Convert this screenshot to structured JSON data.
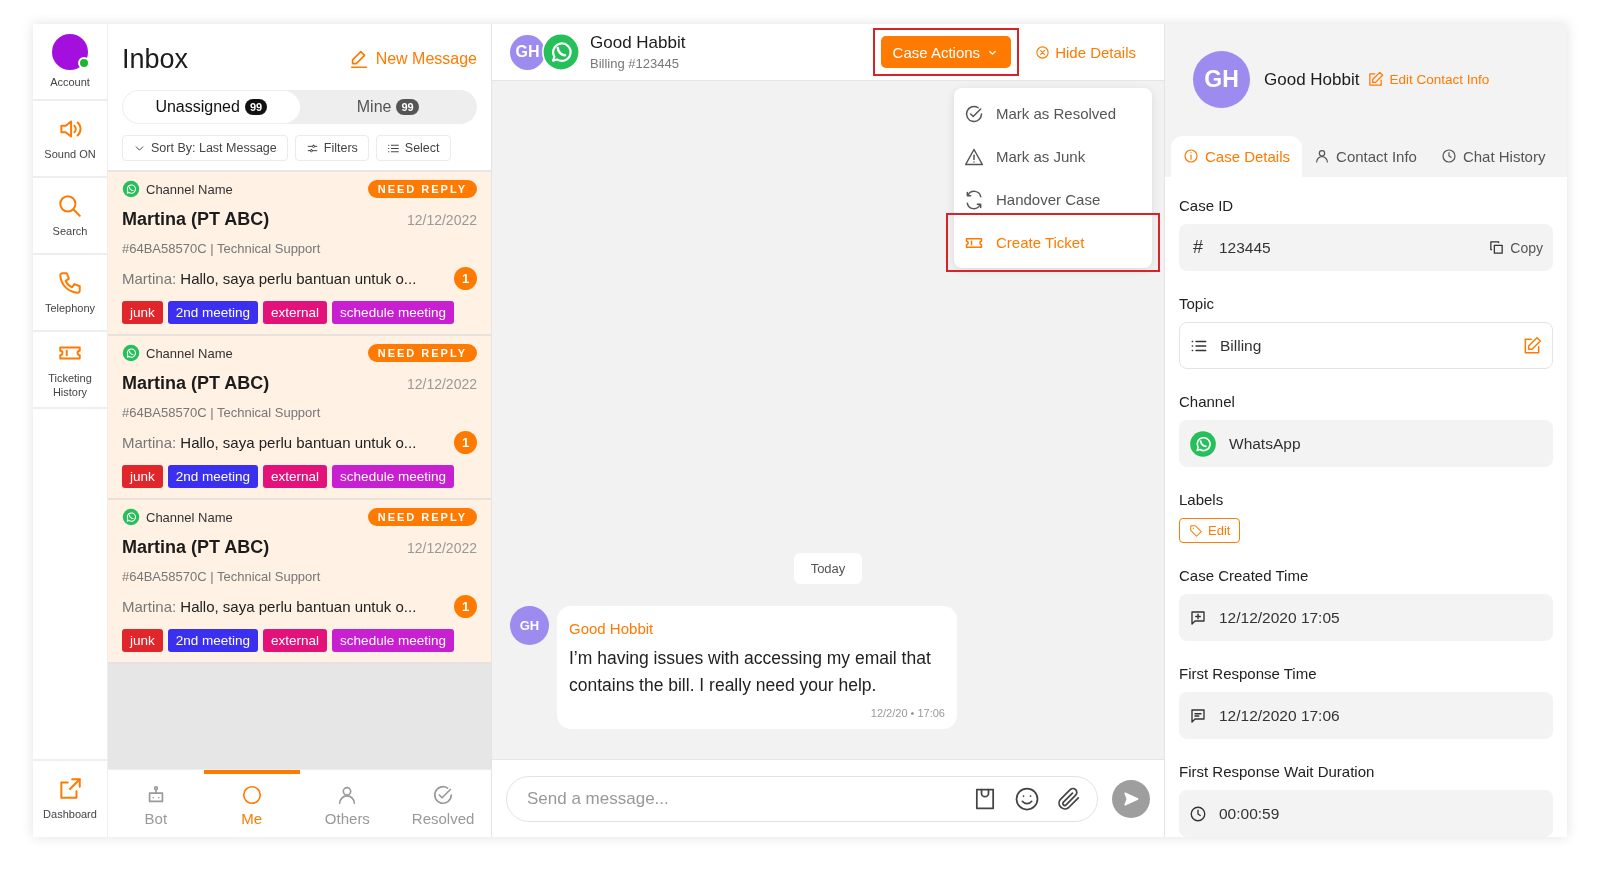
{
  "nav": {
    "account": {
      "label": "Account",
      "online": true
    },
    "items": [
      {
        "kind": "sound",
        "label": "Sound ON"
      },
      {
        "kind": "search",
        "label": "Search"
      },
      {
        "kind": "phone",
        "label": "Telephony"
      },
      {
        "kind": "ticket",
        "label": "Ticketing History"
      }
    ],
    "bottom": {
      "kind": "dashboard",
      "label": "Dashboard"
    }
  },
  "inbox": {
    "title": "Inbox",
    "new_message": "New Message",
    "tabs": [
      {
        "label": "Unassigned",
        "count": "99",
        "selected": true
      },
      {
        "label": "Mine",
        "count": "99",
        "selected": false
      }
    ],
    "toolbar": {
      "sort": "Sort By: Last Message",
      "filters": "Filters",
      "select": "Select"
    },
    "conversations": [
      {
        "channel": "Channel Name",
        "status": "NEED REPLY",
        "name": "Martina (PT ABC)",
        "date": "12/12/2022",
        "ref": "#64BA58570C | Technical Support",
        "preview_sender": "Martina:",
        "preview_text": "Hallo, saya perlu bantuan untuk o...",
        "unread": "1",
        "labels": [
          {
            "text": "junk",
            "color": "#e0262b"
          },
          {
            "text": "2nd meeting",
            "color": "#3b2ff0"
          },
          {
            "text": "external",
            "color": "#e3127a"
          },
          {
            "text": "schedule meeting",
            "color": "#c81fd0"
          }
        ]
      },
      {
        "channel": "Channel Name",
        "status": "NEED REPLY",
        "name": "Martina (PT ABC)",
        "date": "12/12/2022",
        "ref": "#64BA58570C | Technical Support",
        "preview_sender": "Martina:",
        "preview_text": "Hallo, saya perlu bantuan untuk o...",
        "unread": "1",
        "labels": [
          {
            "text": "junk",
            "color": "#e0262b"
          },
          {
            "text": "2nd meeting",
            "color": "#3b2ff0"
          },
          {
            "text": "external",
            "color": "#e3127a"
          },
          {
            "text": "schedule meeting",
            "color": "#c81fd0"
          }
        ]
      },
      {
        "channel": "Channel Name",
        "status": "NEED REPLY",
        "name": "Martina (PT ABC)",
        "date": "12/12/2022",
        "ref": "#64BA58570C | Technical Support",
        "preview_sender": "Martina:",
        "preview_text": "Hallo, saya perlu bantuan untuk o...",
        "unread": "1",
        "labels": [
          {
            "text": "junk",
            "color": "#e0262b"
          },
          {
            "text": "2nd meeting",
            "color": "#3b2ff0"
          },
          {
            "text": "external",
            "color": "#e3127a"
          },
          {
            "text": "schedule meeting",
            "color": "#c81fd0"
          }
        ]
      }
    ],
    "bottom_tabs": [
      {
        "kind": "bot",
        "label": "Bot",
        "selected": false
      },
      {
        "kind": "me",
        "label": "Me",
        "selected": true
      },
      {
        "kind": "others",
        "label": "Others",
        "selected": false
      },
      {
        "kind": "resolved",
        "label": "Resolved",
        "selected": false
      }
    ]
  },
  "chat": {
    "initials": "GH",
    "name": "Good Habbit",
    "subtitle": "Billing #123445",
    "case_actions": {
      "label": "Case Actions",
      "highlighted": true
    },
    "hide_details": "Hide Details",
    "menu": [
      {
        "kind": "resolved",
        "label": "Mark as Resolved",
        "selected": false,
        "highlighted": false
      },
      {
        "kind": "warning",
        "label": "Mark as Junk",
        "selected": false,
        "highlighted": false
      },
      {
        "kind": "handover",
        "label": "Handover Case",
        "selected": false,
        "highlighted": false
      },
      {
        "kind": "ticket",
        "label": "Create Ticket",
        "selected": true,
        "highlighted": true
      }
    ],
    "date_divider": "Today",
    "message": {
      "initials": "GH",
      "sender": "Good Hobbit",
      "text": "I’m having issues with accessing my email that contains the bill. I really need your help.",
      "time": "12/2/20 • 17:06"
    },
    "composer": {
      "placeholder": "Send a message..."
    }
  },
  "details": {
    "initials": "GH",
    "name": "Good Hobbit",
    "edit_link": "Edit Contact Info",
    "tabs": [
      {
        "kind": "info",
        "label": "Case Details",
        "selected": true
      },
      {
        "kind": "others",
        "label": "Contact Info",
        "selected": false
      },
      {
        "kind": "clock",
        "label": "Chat History",
        "selected": false
      }
    ],
    "fields": [
      {
        "kind": "id",
        "label": "Case ID",
        "prefix": "#",
        "value": "123445",
        "action": "Copy"
      },
      {
        "kind": "topic",
        "label": "Topic",
        "value": "Billing"
      },
      {
        "kind": "channel",
        "label": "Channel",
        "value": "WhatsApp"
      },
      {
        "kind": "labels",
        "label": "Labels",
        "action": "Edit"
      },
      {
        "kind": "created",
        "label": "Case Created Time",
        "value": "12/12/2020 17:05"
      },
      {
        "kind": "responded",
        "label": "First Response Time",
        "value": "12/12/2020 17:06"
      },
      {
        "kind": "wait",
        "label": "First Response Wait Duration",
        "value": "00:00:59"
      }
    ]
  }
}
